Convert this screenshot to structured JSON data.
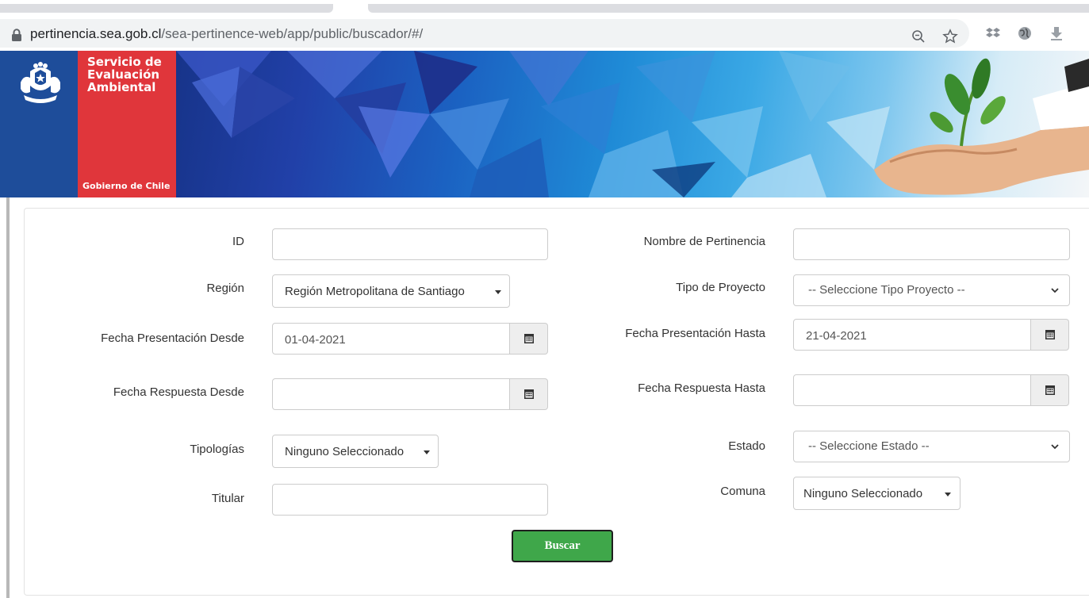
{
  "browser": {
    "url_host": "pertinencia.sea.gob.cl",
    "url_path": "/sea-pertinence-web/app/public/buscador/#/"
  },
  "banner": {
    "line1": "Servicio de",
    "line2": "Evaluación",
    "line3": "Ambiental",
    "gobierno": "Gobierno de Chile"
  },
  "form": {
    "id_label": "ID",
    "id_value": "",
    "nombre_label": "Nombre de Pertinencia",
    "nombre_value": "",
    "region_label": "Región",
    "region_value": "Región Metropolitana de Santiago",
    "tipo_proyecto_label": "Tipo de Proyecto",
    "tipo_proyecto_value": "-- Seleccione Tipo Proyecto --",
    "fecha_pres_desde_label": "Fecha Presentación Desde",
    "fecha_pres_desde_value": "01-04-2021",
    "fecha_pres_hasta_label": "Fecha Presentación Hasta",
    "fecha_pres_hasta_value": "21-04-2021",
    "fecha_resp_desde_label": "Fecha Respuesta Desde",
    "fecha_resp_desde_value": "",
    "fecha_resp_hasta_label": "Fecha Respuesta Hasta",
    "fecha_resp_hasta_value": "",
    "tipologias_label": "Tipologías",
    "tipologias_value": "Ninguno Seleccionado",
    "estado_label": "Estado",
    "estado_value": "-- Seleccione Estado --",
    "titular_label": "Titular",
    "titular_value": "",
    "comuna_label": "Comuna",
    "comuna_value": "Ninguno Seleccionado",
    "buscar_label": "Buscar"
  },
  "colors": {
    "buscar_bg": "#3fa74a",
    "banner_red": "#e0363b"
  }
}
